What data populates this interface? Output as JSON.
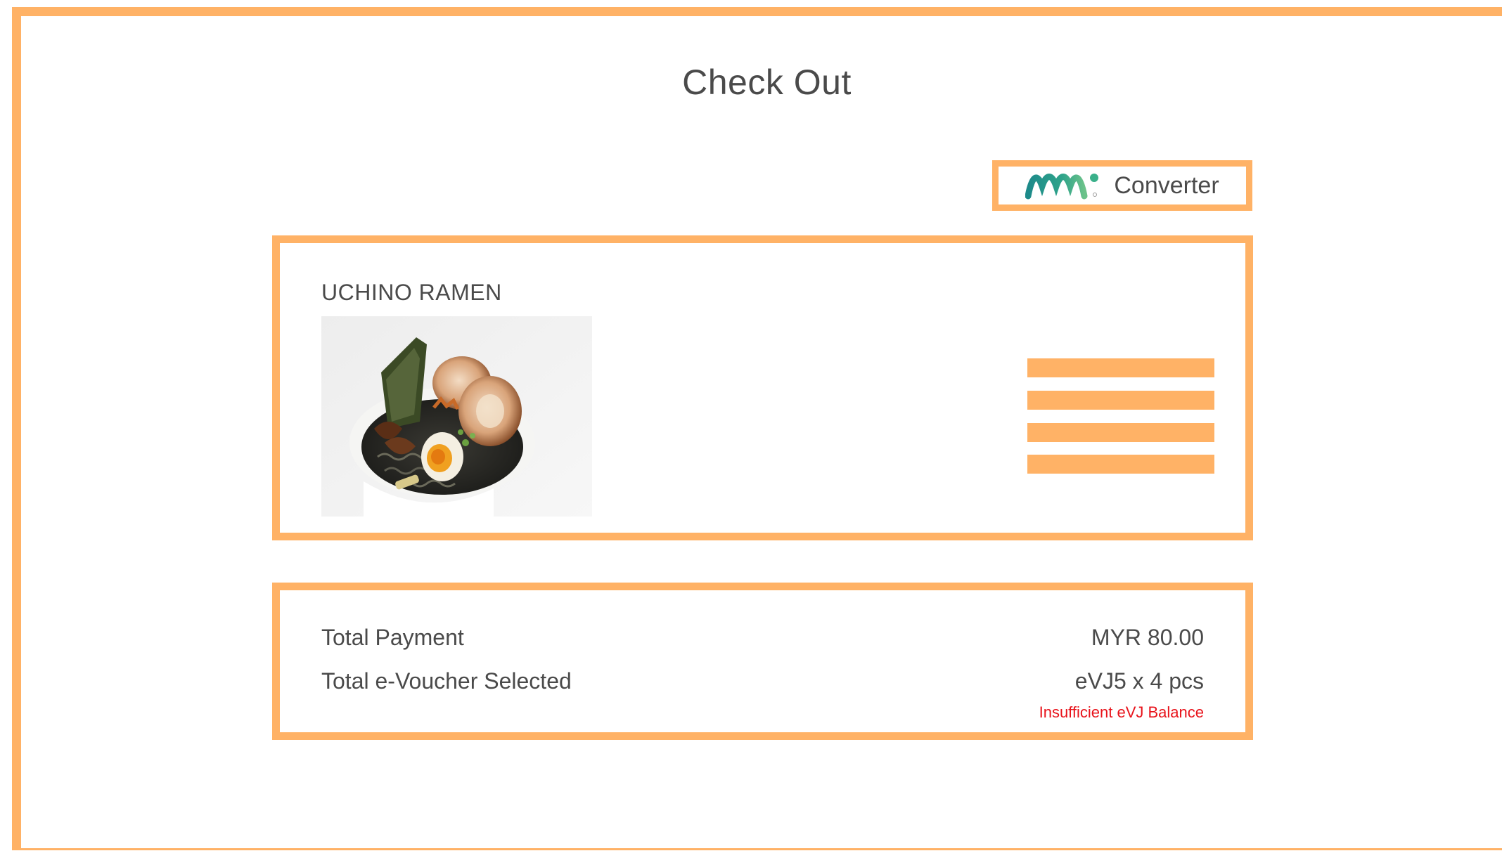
{
  "page": {
    "title": "Check Out",
    "accent_color": "#FFB266",
    "warning_color": "#e8131b"
  },
  "converter": {
    "logo_icon": "mm-logo-icon",
    "label": "Converter"
  },
  "item": {
    "name": "UCHINO RAMEN",
    "image_icon": "ramen-bowl-image",
    "menu_icon": "hamburger-menu-icon"
  },
  "summary": {
    "total_payment_label": "Total Payment",
    "total_payment_value": "MYR 80.00",
    "voucher_label": "Total e-Voucher Selected",
    "voucher_value": "eVJ5 x 4 pcs",
    "warning": "Insufficient eVJ Balance"
  }
}
